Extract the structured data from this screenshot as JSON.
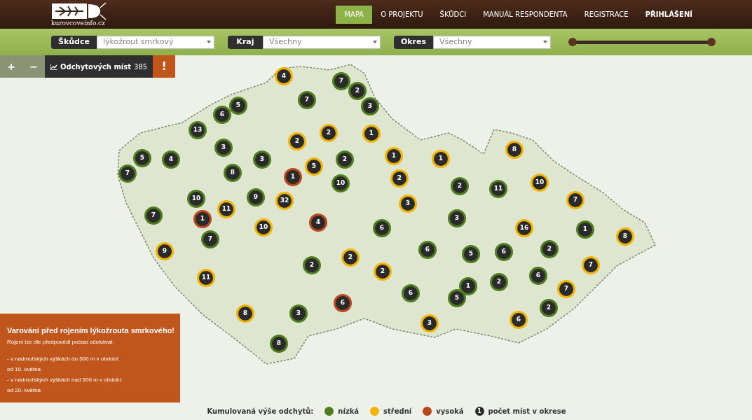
{
  "logo": {
    "text": "kurovcoveinfo.cz"
  },
  "nav": [
    {
      "label": "MAPA",
      "selected": true,
      "emphasized": false
    },
    {
      "label": "O PROJEKTU",
      "selected": false,
      "emphasized": false
    },
    {
      "label": "ŠKŮDCI",
      "selected": false,
      "emphasized": false
    },
    {
      "label": "MANUÁL RESPONDENTA",
      "selected": false,
      "emphasized": false
    },
    {
      "label": "REGISTRACE",
      "selected": false,
      "emphasized": false
    },
    {
      "label": "PŘIHLÁŠENÍ",
      "selected": false,
      "emphasized": true
    }
  ],
  "filters": [
    {
      "label": "Škůdce",
      "value": "lýkožrout smrkový"
    },
    {
      "label": "Kraj",
      "value": "Všechny"
    },
    {
      "label": "Okres",
      "value": "Všechny"
    }
  ],
  "slider": {
    "level": 1
  },
  "toolbar": {
    "zoom_in": "+",
    "zoom_out": "−",
    "count_label": "Odchytových míst",
    "count": "385",
    "alert": "!"
  },
  "markers": [
    {
      "count": "4",
      "color": "#f0b400"
    },
    {
      "count": "7",
      "color": "#4e7d1e"
    },
    {
      "count": "2",
      "color": "#4e7d1e"
    },
    {
      "count": "5",
      "color": "#4e7d1e"
    },
    {
      "count": "7",
      "color": "#4e7d1e"
    },
    {
      "count": "3",
      "color": "#4e7d1e"
    },
    {
      "count": "6",
      "color": "#4e7d1e"
    },
    {
      "count": "13",
      "color": "#4e7d1e"
    },
    {
      "count": "2",
      "color": "#f0b400"
    },
    {
      "count": "1",
      "color": "#f0b400"
    },
    {
      "count": "2",
      "color": "#f0b400"
    },
    {
      "count": "3",
      "color": "#4e7d1e"
    },
    {
      "count": "5",
      "color": "#4e7d1e"
    },
    {
      "count": "4",
      "color": "#4e7d1e"
    },
    {
      "count": "3",
      "color": "#4e7d1e"
    },
    {
      "count": "2",
      "color": "#4e7d1e"
    },
    {
      "count": "1",
      "color": "#f0b400"
    },
    {
      "count": "1",
      "color": "#f0b400"
    },
    {
      "count": "8",
      "color": "#f0b400"
    },
    {
      "count": "5",
      "color": "#f0b400"
    },
    {
      "count": "7",
      "color": "#4e7d1e"
    },
    {
      "count": "8",
      "color": "#4e7d1e"
    },
    {
      "count": "1",
      "color": "#b8471b"
    },
    {
      "count": "2",
      "color": "#f0b400"
    },
    {
      "count": "10",
      "color": "#4e7d1e"
    },
    {
      "count": "2",
      "color": "#4e7d1e"
    },
    {
      "count": "11",
      "color": "#4e7d1e"
    },
    {
      "count": "10",
      "color": "#f0b400"
    },
    {
      "count": "9",
      "color": "#4e7d1e"
    },
    {
      "count": "32",
      "color": "#f0b400"
    },
    {
      "count": "10",
      "color": "#4e7d1e"
    },
    {
      "count": "7",
      "color": "#f0b400"
    },
    {
      "count": "11",
      "color": "#f0b400"
    },
    {
      "count": "3",
      "color": "#f0b400"
    },
    {
      "count": "7",
      "color": "#4e7d1e"
    },
    {
      "count": "1",
      "color": "#b8471b"
    },
    {
      "count": "3",
      "color": "#4e7d1e"
    },
    {
      "count": "4",
      "color": "#b8471b"
    },
    {
      "count": "10",
      "color": "#f0b400"
    },
    {
      "count": "6",
      "color": "#4e7d1e"
    },
    {
      "count": "16",
      "color": "#f0b400"
    },
    {
      "count": "1",
      "color": "#4e7d1e"
    },
    {
      "count": "8",
      "color": "#f0b400"
    },
    {
      "count": "7",
      "color": "#4e7d1e"
    },
    {
      "count": "6",
      "color": "#4e7d1e"
    },
    {
      "count": "5",
      "color": "#4e7d1e"
    },
    {
      "count": "6",
      "color": "#4e7d1e"
    },
    {
      "count": "2",
      "color": "#4e7d1e"
    },
    {
      "count": "9",
      "color": "#f0b400"
    },
    {
      "count": "2",
      "color": "#f0b400"
    },
    {
      "count": "2",
      "color": "#4e7d1e"
    },
    {
      "count": "7",
      "color": "#f0b400"
    },
    {
      "count": "2",
      "color": "#f0b400"
    },
    {
      "count": "6",
      "color": "#4e7d1e"
    },
    {
      "count": "11",
      "color": "#f0b400"
    },
    {
      "count": "1",
      "color": "#4e7d1e"
    },
    {
      "count": "2",
      "color": "#4e7d1e"
    },
    {
      "count": "7",
      "color": "#f0b400"
    },
    {
      "count": "6",
      "color": "#4e7d1e"
    },
    {
      "count": "5",
      "color": "#4e7d1e"
    },
    {
      "count": "2",
      "color": "#4e7d1e"
    },
    {
      "count": "6",
      "color": "#b8471b"
    },
    {
      "count": "8",
      "color": "#f0b400"
    },
    {
      "count": "3",
      "color": "#4e7d1e"
    },
    {
      "count": "6",
      "color": "#f0b400"
    },
    {
      "count": "3",
      "color": "#f0b400"
    },
    {
      "count": "8",
      "color": "#4e7d1e"
    }
  ],
  "warning": {
    "title": "Varování před rojením lýkožrouta smrkového!",
    "intro": "Rojení lze dle předpovědi počasí očekávat:",
    "lines": [
      "- v nadmořských výškách do 500 m v období:",
      "od 10. května",
      "- v nadmořských výškách nad 500 m v období:",
      "od 20. května"
    ]
  },
  "legend": {
    "title": "Kumulovaná výše odchytů:",
    "items": [
      {
        "kind": "swatch",
        "color": "#4e7d1e",
        "label": "nízká"
      },
      {
        "kind": "swatch",
        "color": "#f0b400",
        "label": "střední"
      },
      {
        "kind": "swatch",
        "color": "#b8471b",
        "label": "vysoká"
      },
      {
        "kind": "count",
        "symbol": "1",
        "label": "počet míst v okrese"
      }
    ]
  }
}
